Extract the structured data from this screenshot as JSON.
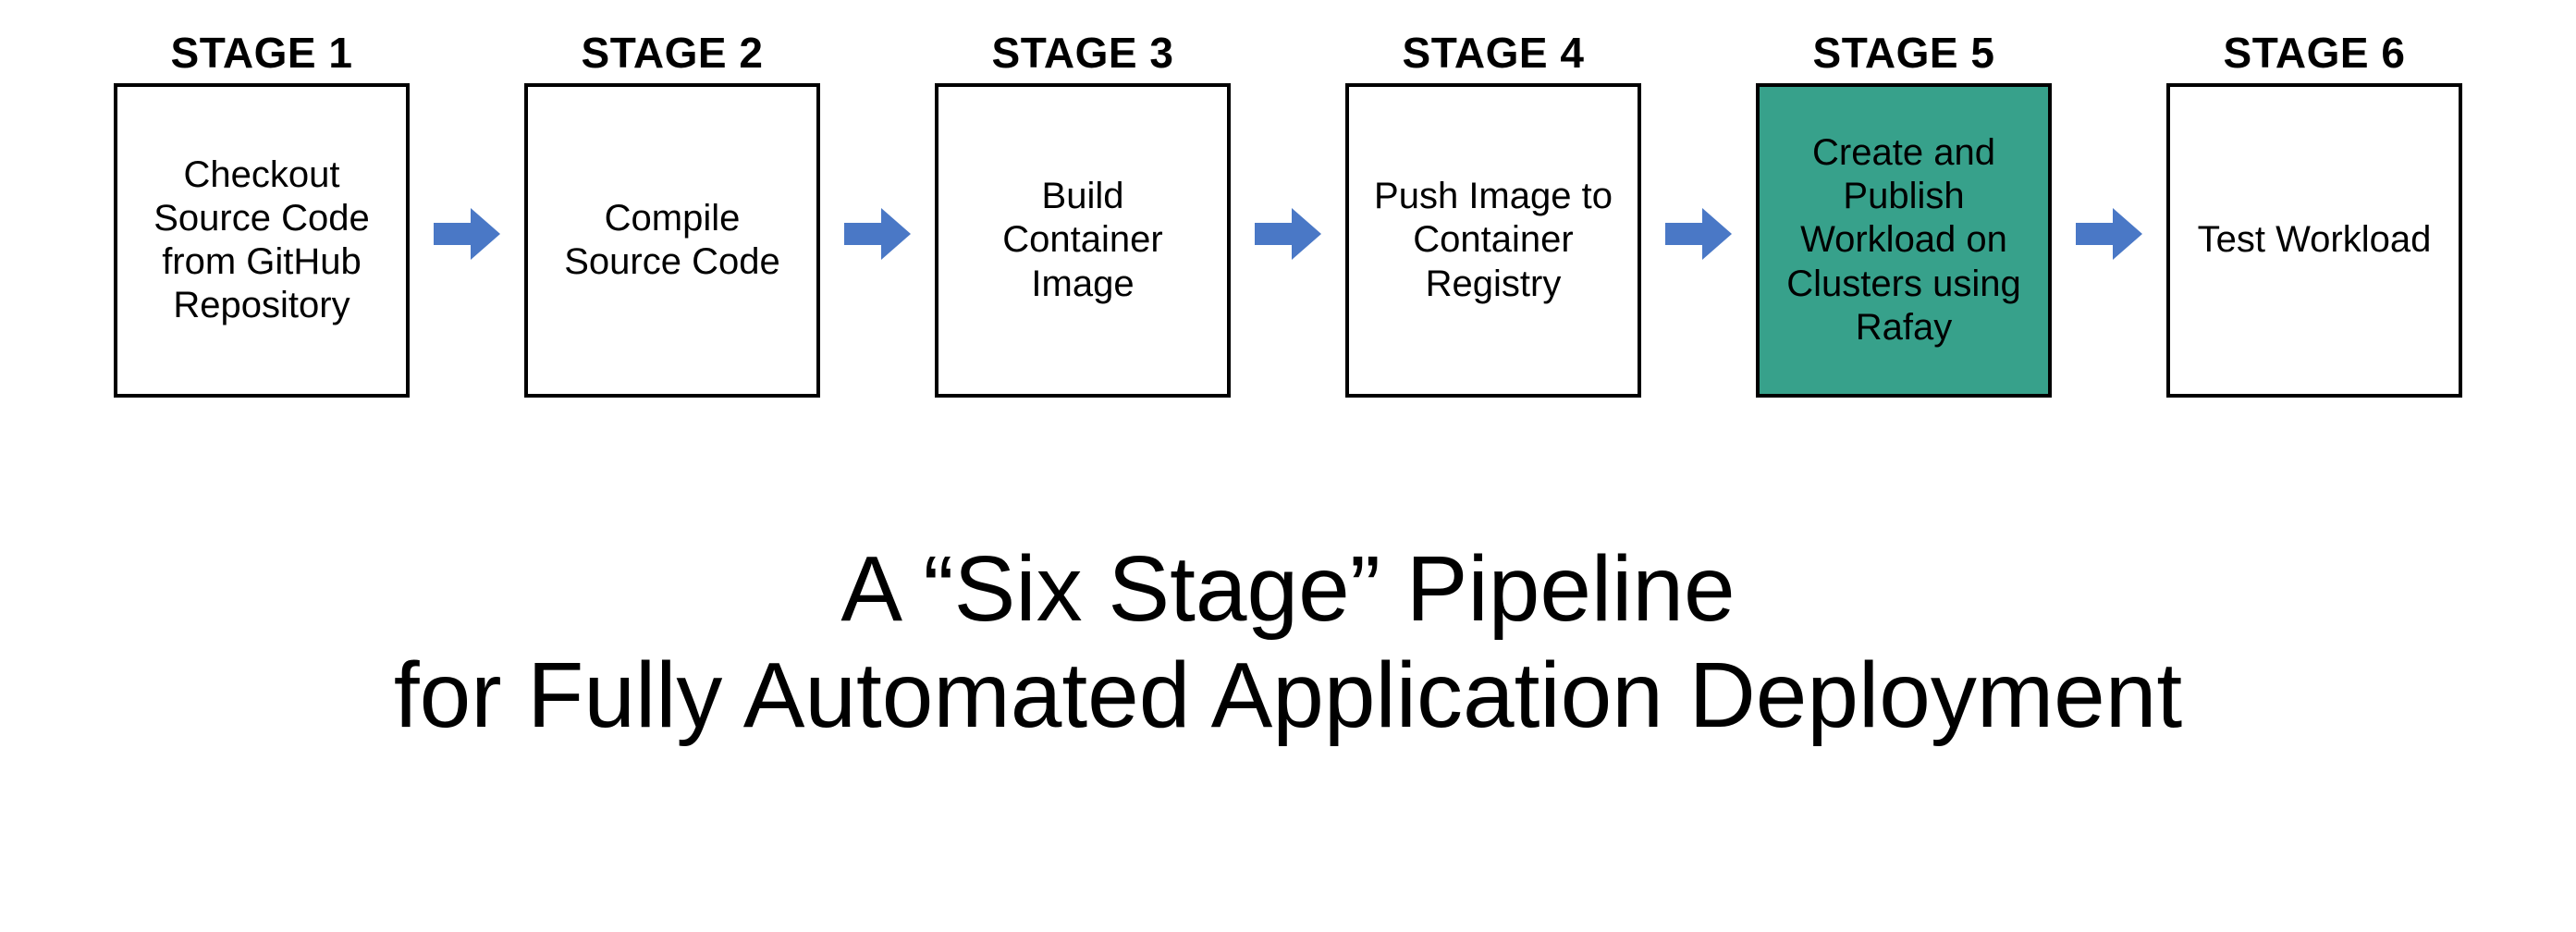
{
  "stages": [
    {
      "header": "STAGE 1",
      "desc": "Checkout Source Code from GitHub Repository",
      "highlight": false
    },
    {
      "header": "STAGE 2",
      "desc": "Compile Source Code",
      "highlight": false
    },
    {
      "header": "STAGE 3",
      "desc": "Build Container Image",
      "highlight": false
    },
    {
      "header": "STAGE 4",
      "desc": "Push Image to Container Registry",
      "highlight": false
    },
    {
      "header": "STAGE 5",
      "desc": "Create and Publish Workload on Clusters using Rafay",
      "highlight": true
    },
    {
      "header": "STAGE 6",
      "desc": "Test Workload",
      "highlight": false
    }
  ],
  "caption_line1": "A “Six Stage” Pipeline",
  "caption_line2": "for Fully Automated Application Deployment",
  "colors": {
    "arrow": "#4a78c6",
    "highlight_bg": "#37a18b"
  }
}
